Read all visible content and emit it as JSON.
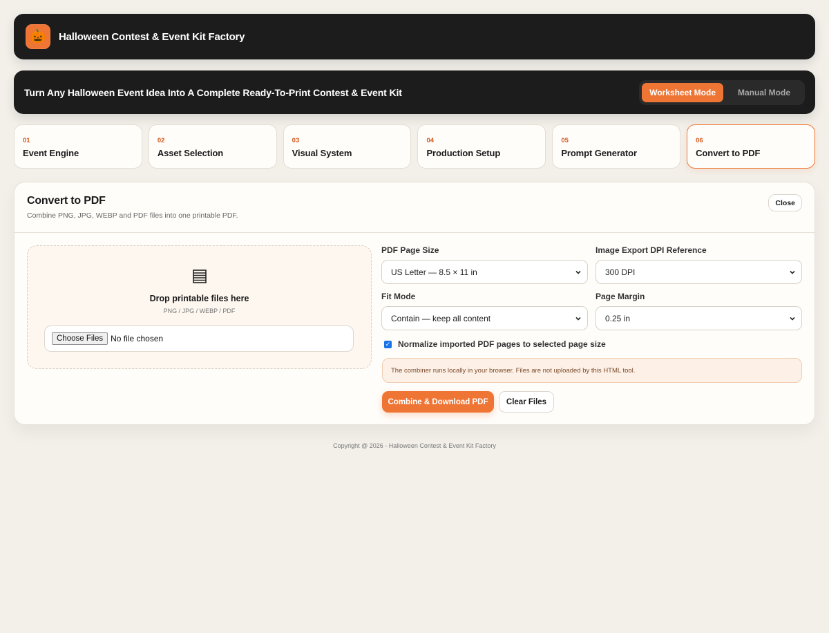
{
  "header": {
    "logo_icon": "pumpkin-icon",
    "logo_glyph": "🎃",
    "title": "Halloween Contest & Event Kit Factory"
  },
  "hero": {
    "headline": "Turn Any Halloween Event Idea Into A Complete Ready-To-Print Contest & Event Kit",
    "modes": [
      {
        "label": "Worksheet Mode",
        "active": true
      },
      {
        "label": "Manual Mode",
        "active": false
      }
    ]
  },
  "steps": [
    {
      "num": "01",
      "label": "Event Engine"
    },
    {
      "num": "02",
      "label": "Asset Selection"
    },
    {
      "num": "03",
      "label": "Visual System"
    },
    {
      "num": "04",
      "label": "Production Setup"
    },
    {
      "num": "05",
      "label": "Prompt Generator"
    },
    {
      "num": "06",
      "label": "Convert to PDF",
      "active": true
    }
  ],
  "panel": {
    "title": "Convert to PDF",
    "subtitle": "Combine PNG, JPG, WEBP and PDF files into one printable PDF.",
    "close_label": "Close",
    "dropzone": {
      "icon": "document-icon",
      "title": "Drop printable files here",
      "types": "PNG / JPG / WEBP / PDF",
      "choose_label": "Choose Files",
      "no_file_text": "No file chosen"
    },
    "fields": {
      "page_size": {
        "label": "PDF Page Size",
        "value": "US Letter — 8.5 × 11 in"
      },
      "dpi": {
        "label": "Image Export DPI Reference",
        "value": "300 DPI"
      },
      "fit_mode": {
        "label": "Fit Mode",
        "value": "Contain — keep all content"
      },
      "margin": {
        "label": "Page Margin",
        "value": "0.25 in"
      }
    },
    "normalize": {
      "label": "Normalize imported PDF pages to selected page size",
      "checked": true
    },
    "notice": "The combiner runs locally in your browser. Files are not uploaded by this HTML tool.",
    "combine_label": "Combine & Download PDF",
    "clear_label": "Clear Files"
  },
  "footer": {
    "copyright": "Copyright @ 2026 - Halloween Contest & Event Kit Factory"
  },
  "colors": {
    "accent": "#ef7535",
    "dark": "#1c1c1c",
    "background": "#f3f0ea"
  }
}
